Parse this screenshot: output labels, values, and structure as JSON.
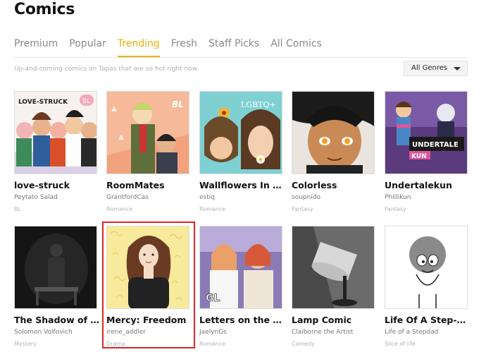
{
  "page_title": "Comics",
  "tabs": [
    {
      "label": "Premium"
    },
    {
      "label": "Popular"
    },
    {
      "label": "Trending"
    },
    {
      "label": "Fresh"
    },
    {
      "label": "Staff Picks"
    },
    {
      "label": "All Comics"
    }
  ],
  "active_tab": "Trending",
  "subtitle": "Up-and-coming comics on Tapas that are so hot right now",
  "genre_filter": {
    "selected": "All Genres"
  },
  "accent_color": "#e8b10b",
  "comics": [
    {
      "title": "love-struck",
      "author": "Peytato Salad",
      "genre": "BL",
      "cover_text": "LOVE-STRUCK",
      "cover_badge": "BL"
    },
    {
      "title": "RoomMates",
      "author": "GrantfordCas",
      "genre": "Romance",
      "cover_badge": "BL"
    },
    {
      "title": "Wallflowers In B...",
      "author": "estiq",
      "genre": "Romance",
      "cover_text": "LGBTQ+"
    },
    {
      "title": "Colorless",
      "author": "soupnido",
      "genre": "Fantasy"
    },
    {
      "title": "Undertalekun",
      "author": "Phillikun",
      "genre": "Fantasy",
      "cover_text": "UNDERTALE",
      "cover_text2": "KUN"
    },
    {
      "title": "The Shadow of ...",
      "author": "Solomon Volfovich",
      "genre": "Mystery"
    },
    {
      "title": "Mercy: Freedom",
      "author": "irene_addler",
      "genre": "Drama"
    },
    {
      "title": "Letters on the w...",
      "author": "JaelynGs",
      "genre": "Romance",
      "cover_text": "GL"
    },
    {
      "title": "Lamp Comic",
      "author": "Claiborne the Artist",
      "genre": "Comedy"
    },
    {
      "title": "Life Of A Step-D...",
      "author": "Life of a Stepdad",
      "genre": "Slice of life"
    }
  ]
}
